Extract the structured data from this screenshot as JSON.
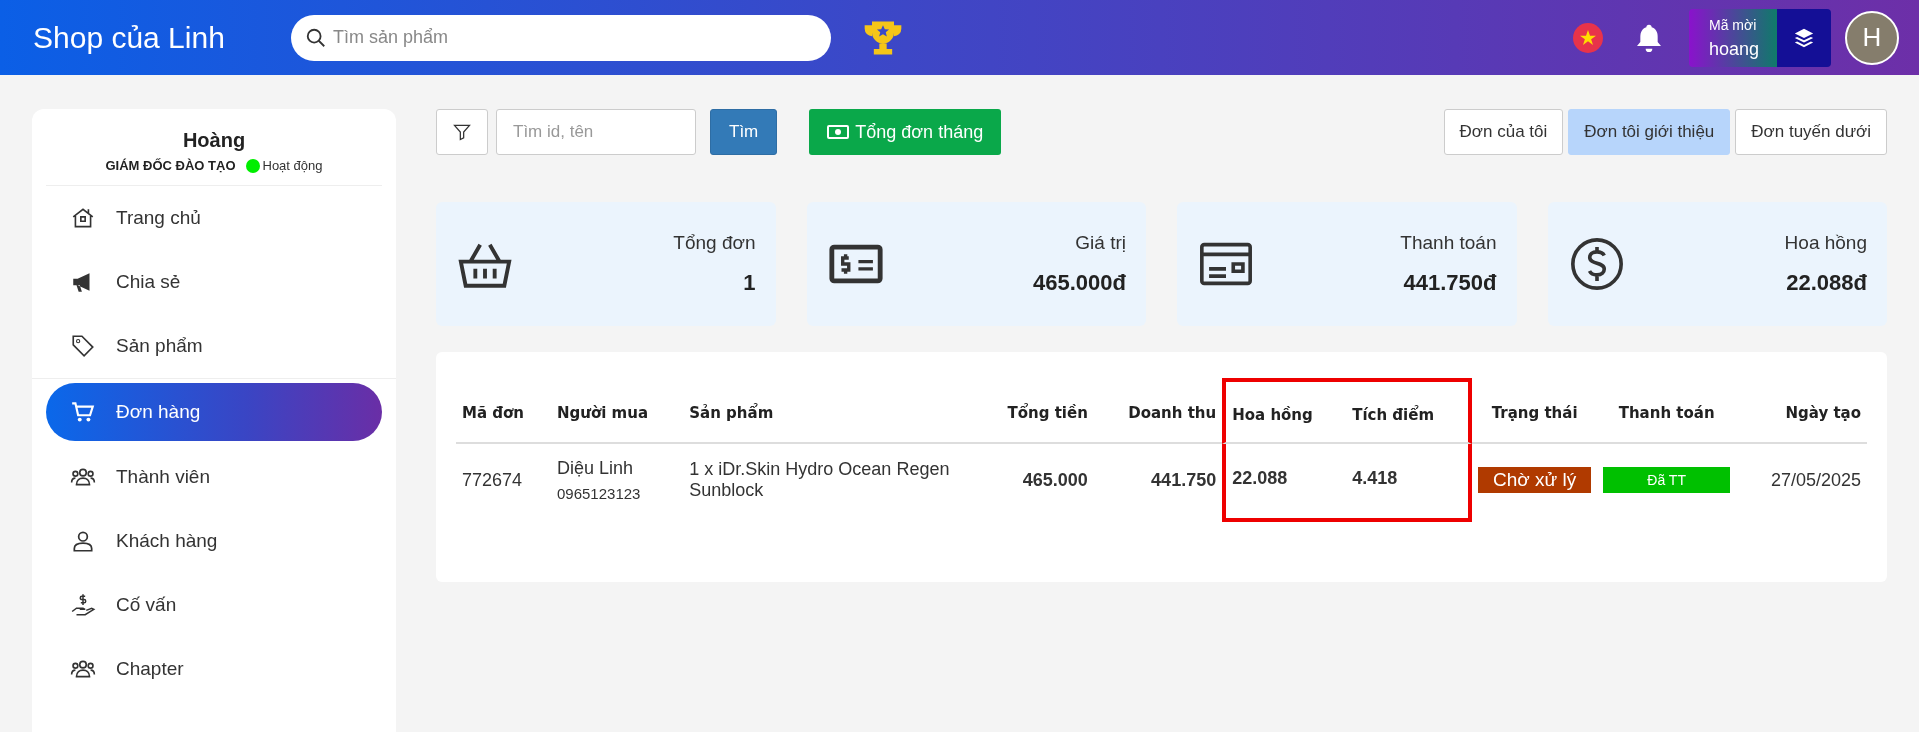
{
  "header": {
    "brand": "Shop của Linh",
    "search": {
      "placeholder": "Tìm sản phẩm"
    },
    "invite": {
      "label": "Mã mời",
      "code": "hoang"
    },
    "avatar": "H"
  },
  "sidebar": {
    "user": {
      "name": "Hoàng",
      "role": "GIÁM ĐỐC ĐÀO TẠO",
      "status": "Hoạt động"
    },
    "items": [
      {
        "label": "Trang chủ",
        "selected": false
      },
      {
        "label": "Chia sẻ",
        "selected": false
      },
      {
        "label": "Sản phẩm",
        "selected": false
      },
      {
        "label": "Đơn hàng",
        "selected": true
      },
      {
        "label": "Thành viên",
        "selected": false
      },
      {
        "label": "Khách hàng",
        "selected": false
      },
      {
        "label": "Cố vấn",
        "selected": false
      },
      {
        "label": "Chapter",
        "selected": false
      }
    ]
  },
  "toolbar": {
    "search": {
      "placeholder": "Tìm id, tên"
    },
    "search_button": "Tìm",
    "monthly_button": "Tổng đơn tháng",
    "tabs": [
      {
        "label": "Đơn của tôi",
        "selected": false
      },
      {
        "label": "Đơn tôi giới thiệu",
        "selected": true
      },
      {
        "label": "Đơn tuyến dưới",
        "selected": false
      }
    ]
  },
  "stats": [
    {
      "label": "Tổng đơn",
      "value": "1"
    },
    {
      "label": "Giá trị",
      "value": "465.000đ"
    },
    {
      "label": "Thanh toán",
      "value": "441.750đ"
    },
    {
      "label": "Hoa hồng",
      "value": "22.088đ"
    }
  ],
  "table": {
    "columns": [
      {
        "label": "Mã đơn",
        "highlighted": false
      },
      {
        "label": "Người mua",
        "highlighted": false
      },
      {
        "label": "Sản phẩm",
        "highlighted": false
      },
      {
        "label": "Tổng tiền",
        "highlighted": false
      },
      {
        "label": "Doanh thu",
        "highlighted": false
      },
      {
        "label": "Hoa hồng",
        "highlighted": true
      },
      {
        "label": "Tích điểm",
        "highlighted": true
      },
      {
        "label": "Trạng thái",
        "highlighted": false
      },
      {
        "label": "Thanh toán",
        "highlighted": false
      },
      {
        "label": "Ngày tạo",
        "highlighted": false
      }
    ],
    "rows": [
      {
        "id": "772674",
        "buyer": "Diệu Linh",
        "phone": "0965123123",
        "product": "1 x iDr.Skin Hydro Ocean Regen Sunblock",
        "total": "465.000",
        "revenue": "441.750",
        "commission": "22.088",
        "points": "4.418",
        "status": {
          "label": "Chờ xử lý",
          "color": "#b03a00"
        },
        "payment": {
          "label": "Đã TT",
          "color": "#00c000"
        },
        "date": "27/05/2025"
      }
    ]
  }
}
